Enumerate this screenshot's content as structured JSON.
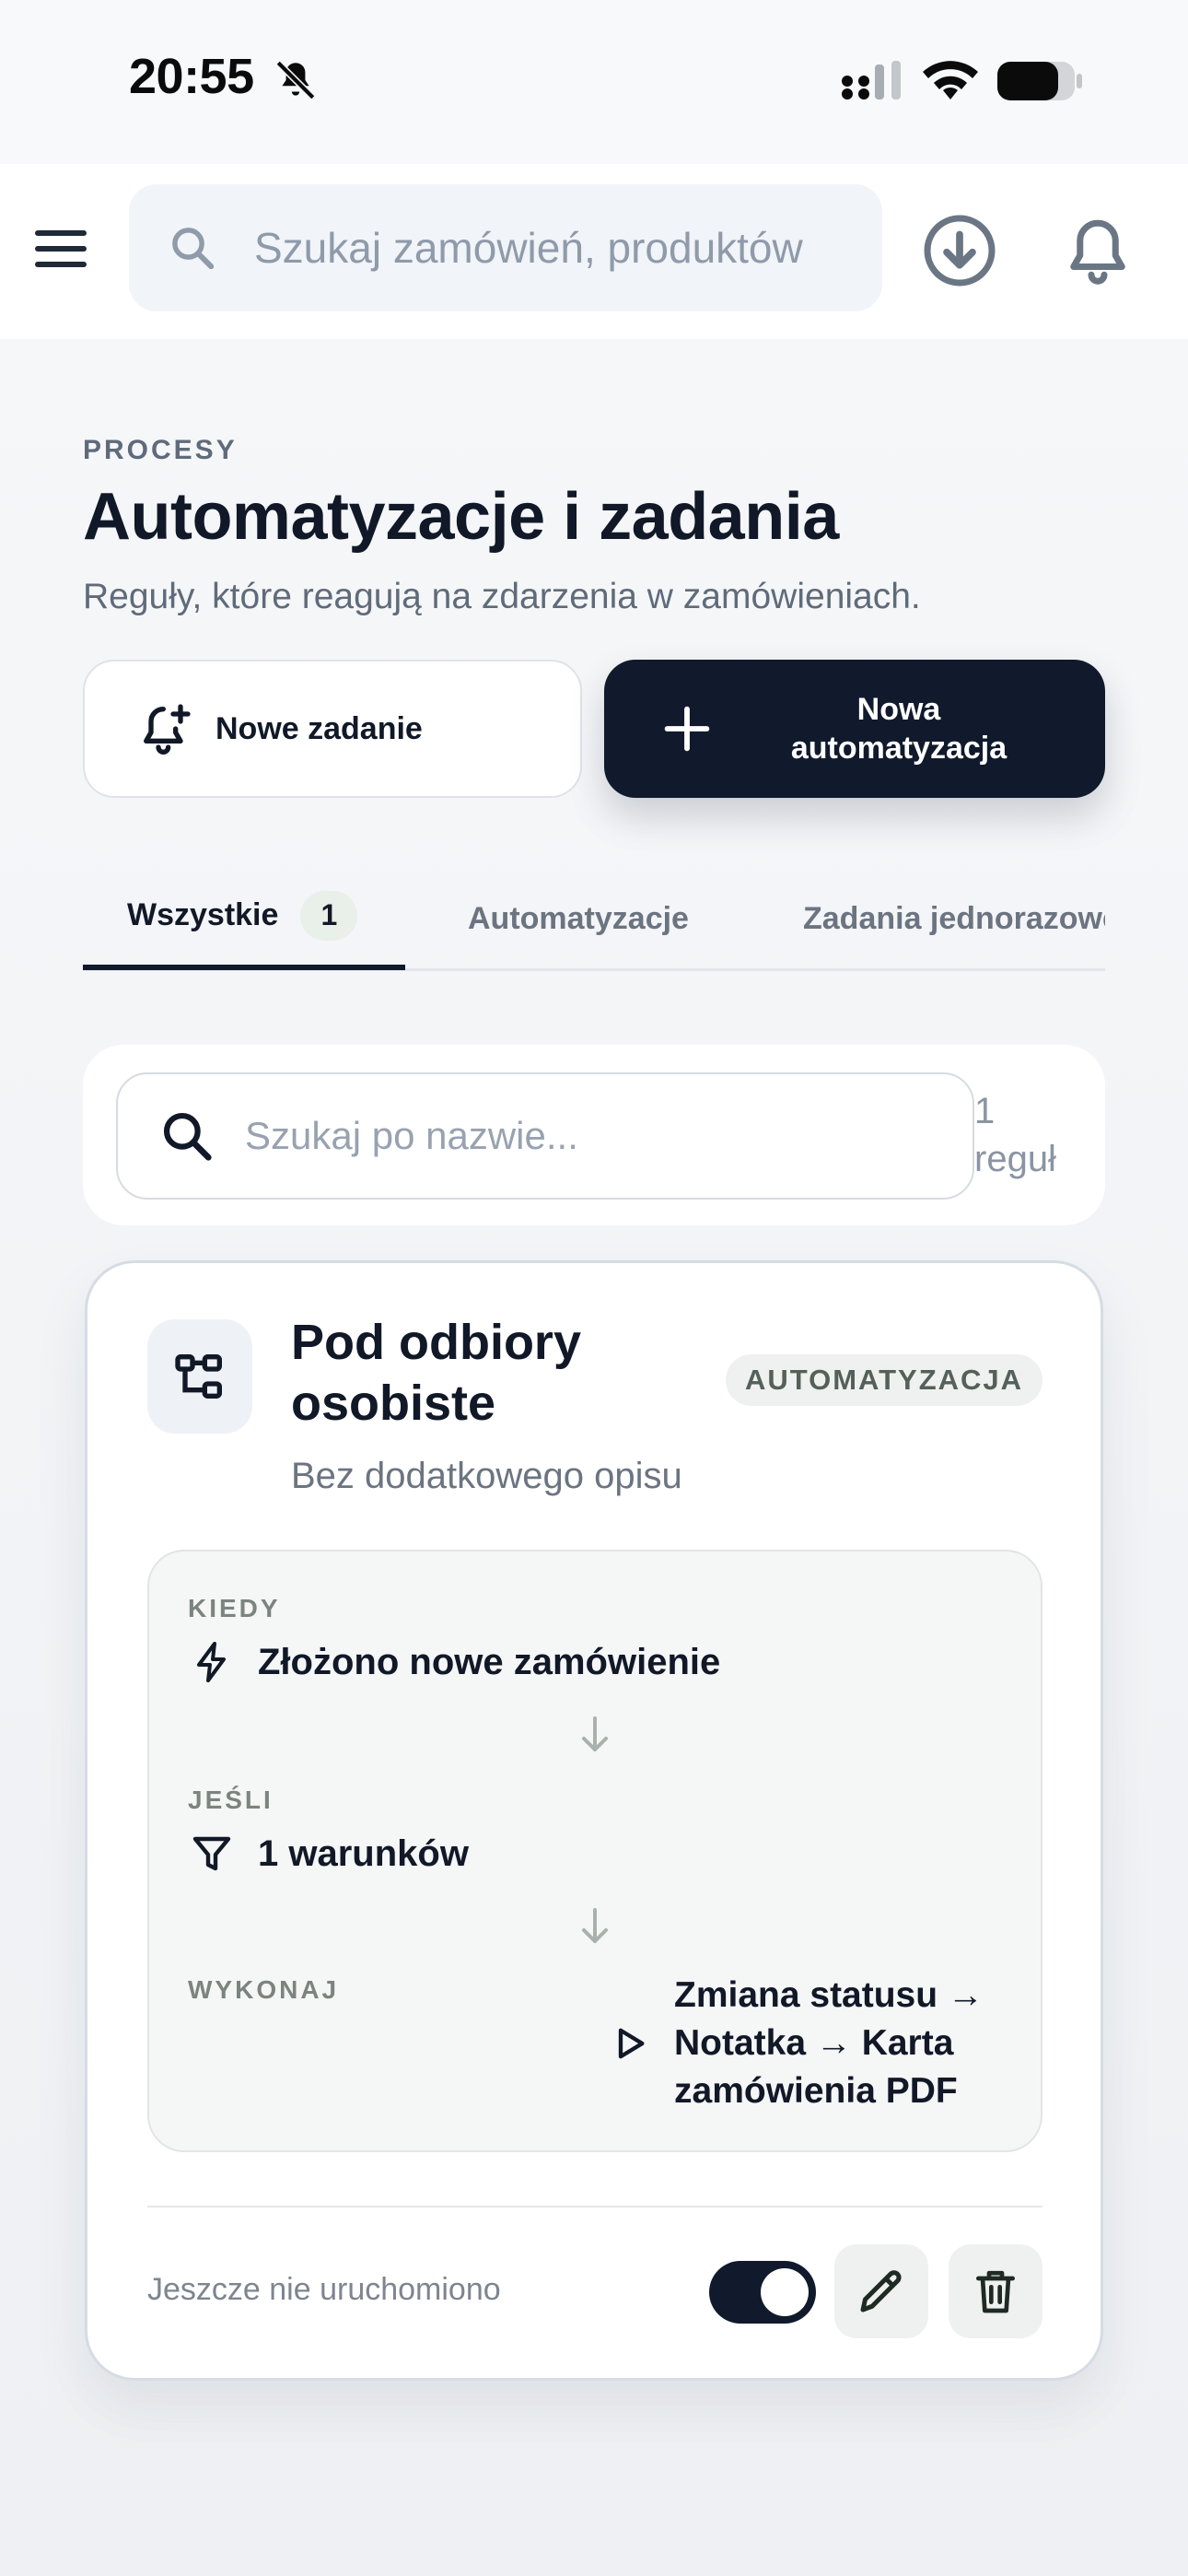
{
  "status_bar": {
    "time": "20:55"
  },
  "top_bar": {
    "search_placeholder": "Szukaj zamówień, produktów"
  },
  "header": {
    "eyebrow": "PROCESY",
    "title": "Automatyzacje i zadania",
    "subtitle": "Reguły, które reagują na zdarzenia w zamówieniach."
  },
  "actions": {
    "new_task_label": "Nowe zadanie",
    "new_automation_label": "Nowa automatyzacja"
  },
  "tabs": [
    {
      "label": "Wszystkie",
      "count": "1",
      "active": true
    },
    {
      "label": "Automatyzacje",
      "active": false
    },
    {
      "label": "Zadania jednorazowe",
      "active": false
    }
  ],
  "filter": {
    "placeholder": "Szukaj po nazwie...",
    "count_number": "1",
    "count_unit": "reguł"
  },
  "rule": {
    "name": "Pod odbiory osobiste",
    "type": "AUTOMATYZACJA",
    "description": "Bez dodatkowego opisu",
    "when_label": "KIEDY",
    "when_value": "Złożono nowe zamówienie",
    "if_label": "JEŚLI",
    "if_value": "1 warunków",
    "do_label": "WYKONAJ",
    "do_value": "Zmiana statusu → Notatka → Karta zamówienia PDF",
    "last_run": "Jeszcze nie uruchomiono",
    "enabled": true
  },
  "colors": {
    "primary_dark": "#111a2c",
    "background": "#f3f4f6",
    "card": "#ffffff",
    "muted_text": "#6b7480"
  },
  "icons": {
    "menu": "menu-icon",
    "search": "search-icon",
    "download": "download-circle-icon",
    "notifications": "bell-icon",
    "new_task": "bell-plus-icon",
    "new_automation": "plus-icon",
    "rule": "workflow-icon",
    "when": "lightning-icon",
    "if": "filter-icon",
    "do": "play-icon",
    "edit": "pencil-icon",
    "delete": "trash-icon"
  }
}
